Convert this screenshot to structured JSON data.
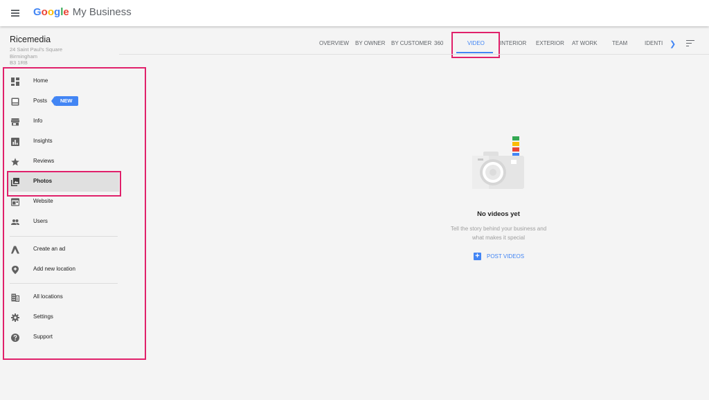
{
  "header": {
    "logo_letters": [
      "G",
      "o",
      "o",
      "g",
      "l",
      "e"
    ],
    "logo_colors": [
      "#4285f4",
      "#ea4335",
      "#fbbc05",
      "#4285f4",
      "#34a853",
      "#ea4335"
    ],
    "product": "My Business",
    "menu_icon": "hamburger-icon"
  },
  "business": {
    "name": "Ricemedia",
    "address_line1": "24 Saint Paul's Square",
    "address_line2": "Birmingham",
    "address_line3": "B3 1RB"
  },
  "sidebar": {
    "items": [
      {
        "label": "Home",
        "icon": "dashboard-icon"
      },
      {
        "label": "Posts",
        "icon": "posts-icon",
        "badge": "NEW"
      },
      {
        "label": "Info",
        "icon": "storefront-icon"
      },
      {
        "label": "Insights",
        "icon": "insights-icon"
      },
      {
        "label": "Reviews",
        "icon": "star-icon"
      },
      {
        "label": "Photos",
        "icon": "photo-library-icon",
        "active": true
      },
      {
        "label": "Website",
        "icon": "web-icon"
      },
      {
        "label": "Users",
        "icon": "people-icon"
      },
      {
        "label": "Create an ad",
        "icon": "adwords-icon"
      },
      {
        "label": "Add new location",
        "icon": "add-location-icon"
      },
      {
        "label": "All locations",
        "icon": "building-icon"
      },
      {
        "label": "Settings",
        "icon": "gear-icon"
      },
      {
        "label": "Support",
        "icon": "help-icon"
      }
    ]
  },
  "tabs": {
    "items": [
      "OVERVIEW",
      "BY OWNER",
      "BY CUSTOMER",
      "360",
      "VIDEO",
      "INTERIOR",
      "EXTERIOR",
      "AT WORK",
      "TEAM",
      "IDENTI"
    ],
    "active": "VIDEO",
    "next_icon": "chevron-right-icon",
    "sort_icon": "sort-icon"
  },
  "empty_state": {
    "icon": "camera-icon",
    "title": "No videos yet",
    "description_line1": "Tell the story behind your business and",
    "description_line2": "what makes it special",
    "action": "POST VIDEOS",
    "stripe_colors": [
      "#34a853",
      "#fbbc05",
      "#ea4335",
      "#4285f4"
    ]
  },
  "colors": {
    "accent": "#4285f4",
    "highlight": "#e0206a"
  }
}
